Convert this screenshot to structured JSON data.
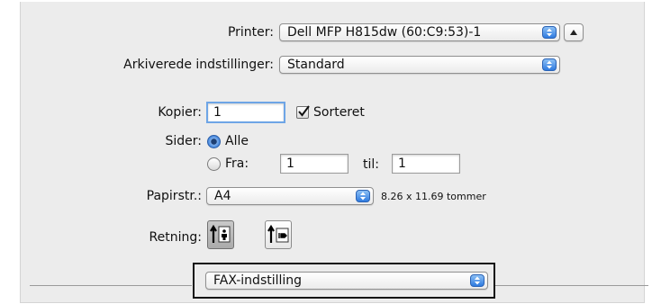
{
  "printer": {
    "label": "Printer:",
    "value": "Dell MFP H815dw (60:C9:53)-1"
  },
  "presets": {
    "label": "Arkiverede indstillinger:",
    "value": "Standard"
  },
  "copies": {
    "label": "Kopier:",
    "value": "1",
    "collate_label": "Sorteret",
    "collate_checked": true
  },
  "pages": {
    "label": "Sider:",
    "all_label": "Alle",
    "from_label": "Fra:",
    "from_value": "1",
    "to_label": "til:",
    "to_value": "1",
    "selected": "all"
  },
  "paper": {
    "label": "Papirstr.:",
    "value": "A4",
    "size_text": "8.26 x 11.69 tommer"
  },
  "orientation": {
    "label": "Retning:",
    "selected": "portrait"
  },
  "section_popup": {
    "value": "FAX-indstilling"
  },
  "colors": {
    "accent": "#2f7be0",
    "panel": "#ececec"
  }
}
